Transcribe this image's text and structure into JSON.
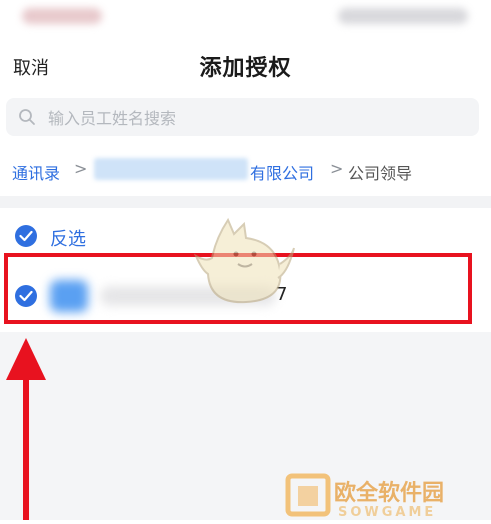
{
  "nav": {
    "cancel_label": "取消",
    "title": "添加授权"
  },
  "search": {
    "placeholder": "输入员工姓名搜索"
  },
  "breadcrumb": {
    "root": "通讯录",
    "company_suffix": "有限公司",
    "current": "公司领导"
  },
  "list": {
    "invert_label": "反选",
    "employee_visible_suffix": "7"
  },
  "watermark": {
    "text": "欧全软件园",
    "latin": "SOWGAME"
  },
  "colors": {
    "accent": "#2f6fe0",
    "highlight": "#e8121f",
    "arrow": "#e8121f"
  },
  "icons": {
    "search": "search-icon",
    "check": "check-icon",
    "chevron": "chevron-right-icon"
  }
}
